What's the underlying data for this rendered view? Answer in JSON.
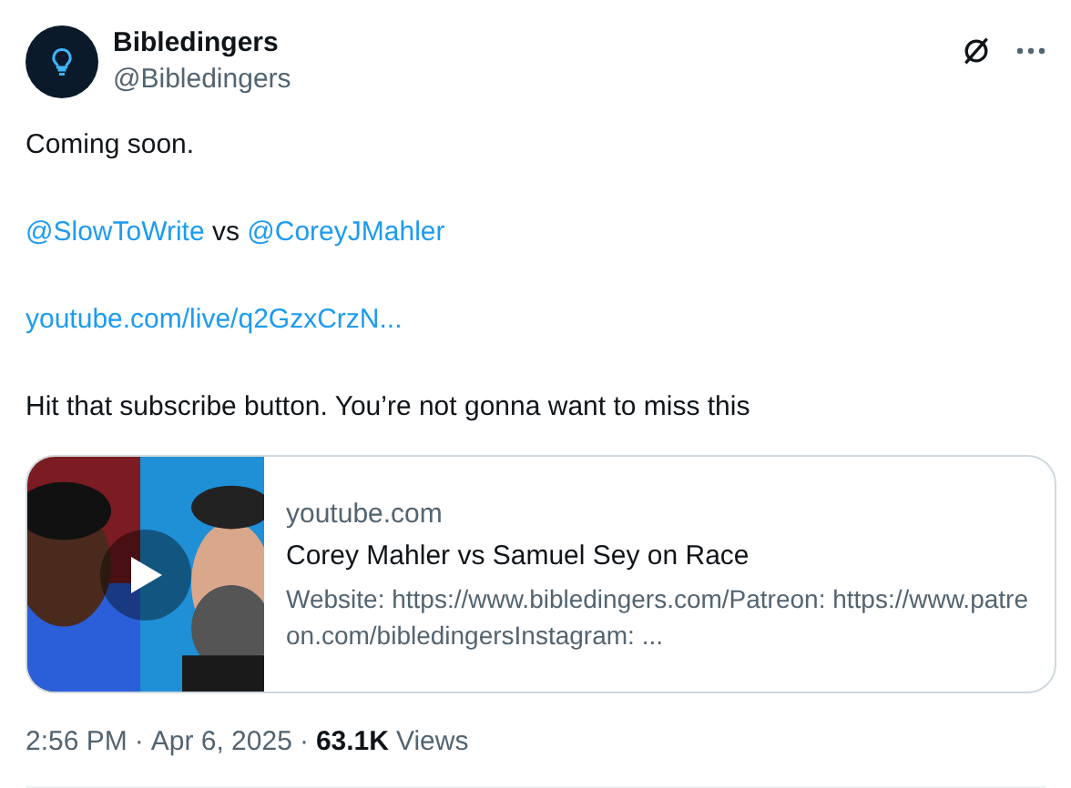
{
  "author": {
    "name": "Bibledingers",
    "handle": "@Bibledingers"
  },
  "body": [
    {
      "kind": "text",
      "text": "Coming soon."
    },
    {
      "kind": "mentions",
      "parts": [
        {
          "kind": "link",
          "text": "@SlowToWrite"
        },
        {
          "kind": "text",
          "text": " vs "
        },
        {
          "kind": "link",
          "text": "@CoreyJMahler"
        }
      ]
    },
    {
      "kind": "link",
      "text": "youtube.com/live/q2GzxCrzN..."
    },
    {
      "kind": "text",
      "text": "Hit that subscribe button. You’re not gonna want to miss this"
    }
  ],
  "card": {
    "domain": "youtube.com",
    "title": "Corey Mahler vs Samuel Sey on Race",
    "description": "Website: https://www.bibledingers.com/Patreon: https://www.patreon.com/bibledingersInstagram: ..."
  },
  "meta": {
    "time": "2:56 PM",
    "separator": "·",
    "date": "Apr 6, 2025",
    "views_count": "63.1K",
    "views_label": "Views"
  }
}
